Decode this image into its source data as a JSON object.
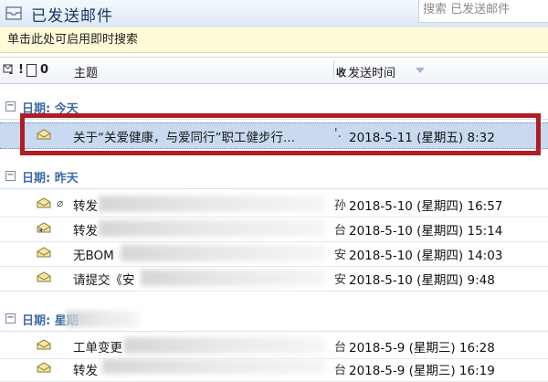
{
  "window": {
    "title": "已发送邮件",
    "search_placeholder": "搜索 已发送邮件"
  },
  "instant_search": {
    "text": "单击此处可启用即时搜索"
  },
  "columns": {
    "flag": "!",
    "attachment": "0",
    "subject": "主题",
    "from_abbrev": "收",
    "sent": "发送时间"
  },
  "groups": [
    {
      "label": "日期: 今天",
      "rows": [
        {
          "subject": "关于“关爱健康，与爱同行”职工健步行...",
          "from": "'.",
          "sent": "2018-5-11 (星期五) 8:32",
          "icon": "envelope-read-icon"
        }
      ]
    },
    {
      "label": "日期: 昨天",
      "rows": [
        {
          "subject": "转发",
          "from": "孙",
          "sent": "2018-5-10 (星期四) 16:57",
          "icon": "envelope-read-icon",
          "attachment": true
        },
        {
          "subject": "转发",
          "from": "台",
          "sent": "2018-5-10 (星期四) 15:14",
          "icon": "envelope-forward-icon"
        },
        {
          "subject": "无BOM",
          "from": "安",
          "sent": "2018-5-10 (星期四) 14:03",
          "icon": "envelope-read-icon"
        },
        {
          "subject": "请提交《安",
          "from": "安",
          "sent": "2018-5-10 (星期四) 9:48",
          "icon": "envelope-read-icon"
        }
      ]
    },
    {
      "label": "日期: 星期",
      "rows": [
        {
          "subject": "工单变更",
          "from": "台",
          "sent": "2018-5-9 (星期三) 16:28",
          "icon": "envelope-read-icon"
        },
        {
          "subject": "转发",
          "from": "台",
          "sent": "2018-5-9 (星期三) 16:19",
          "icon": "envelope-read-icon"
        }
      ]
    }
  ],
  "colors": {
    "group_label": "#3d6aa8",
    "selected_row": "#c9d9ef",
    "highlight_box": "#b01c24",
    "instant_bar": "#fffbd8"
  }
}
